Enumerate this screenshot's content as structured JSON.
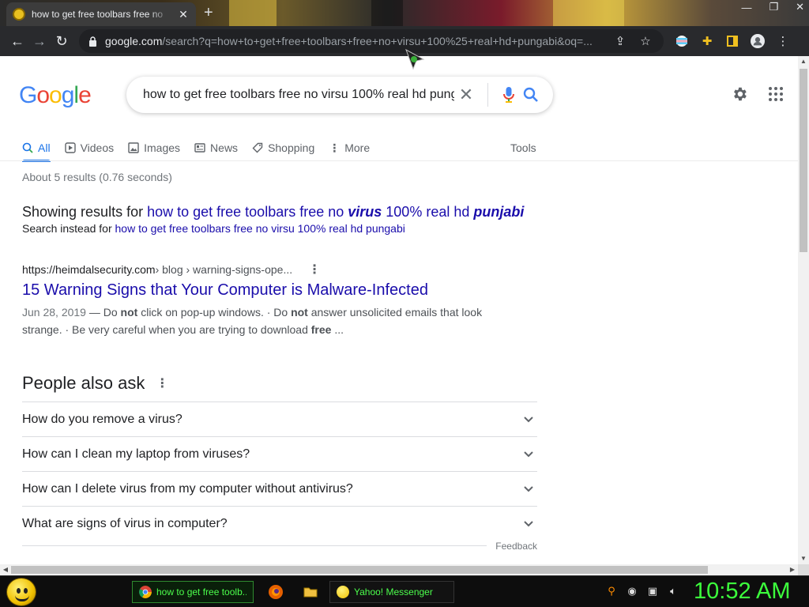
{
  "browser": {
    "tab_title": "how to get free toolbars free no",
    "tab_close": "✕",
    "new_tab": "+",
    "url_host": "google.com",
    "url_path": "/search?q=how+to+get+free+toolbars+free+no+virsu+100%25+real+hd+pungabi&oq=..."
  },
  "google": {
    "logo_letters": [
      "G",
      "o",
      "o",
      "g",
      "l",
      "e"
    ],
    "logo_colors": [
      "#4285F4",
      "#EA4335",
      "#FBBC05",
      "#4285F4",
      "#34A853",
      "#EA4335"
    ],
    "query": "how to get free toolbars free no virsu 100% real hd pungabi",
    "tabs": [
      {
        "label": "All",
        "icon": "search-icon",
        "active": true
      },
      {
        "label": "Videos",
        "icon": "play-icon"
      },
      {
        "label": "Images",
        "icon": "image-icon"
      },
      {
        "label": "News",
        "icon": "news-icon"
      },
      {
        "label": "Shopping",
        "icon": "tag-icon"
      },
      {
        "label": "More",
        "icon": "more-vert-icon"
      }
    ],
    "tools_label": "Tools",
    "stats": "About 5 results (0.76 seconds)",
    "showing_prefix": "Showing results for",
    "showing_a": "how to get free toolbars free no ",
    "showing_b": "virus",
    "showing_c": " 100% real hd ",
    "showing_d": "punjabi",
    "instead_prefix": "Search instead for",
    "instead_link": "how to get free toolbars free no virsu 100% real hd pungabi",
    "result": {
      "site": "https://heimdalsecurity.com",
      "path": " › blog › warning-signs-ope...",
      "title": "15 Warning Signs that Your Computer is Malware-Infected",
      "date": "Jun 28, 2019",
      "snippet_1": " — Do ",
      "snippet_b1": "not",
      "snippet_2": " click on pop-up windows. · Do ",
      "snippet_b2": "not",
      "snippet_3": " answer unsolicited emails that look strange. · Be very careful when you are trying to download ",
      "snippet_b3": "free",
      "snippet_4": " ..."
    },
    "paa_title": "People also ask",
    "paa": [
      "How do you remove a virus?",
      "How can I clean my laptop from viruses?",
      "How can I delete virus from my computer without antivirus?",
      "What are signs of virus in computer?"
    ],
    "feedback": "Feedback"
  },
  "taskbar": {
    "chrome_task": "how to get free toolb...",
    "yahoo_task": "Yahoo! Messenger",
    "clock": "10:52 AM"
  }
}
